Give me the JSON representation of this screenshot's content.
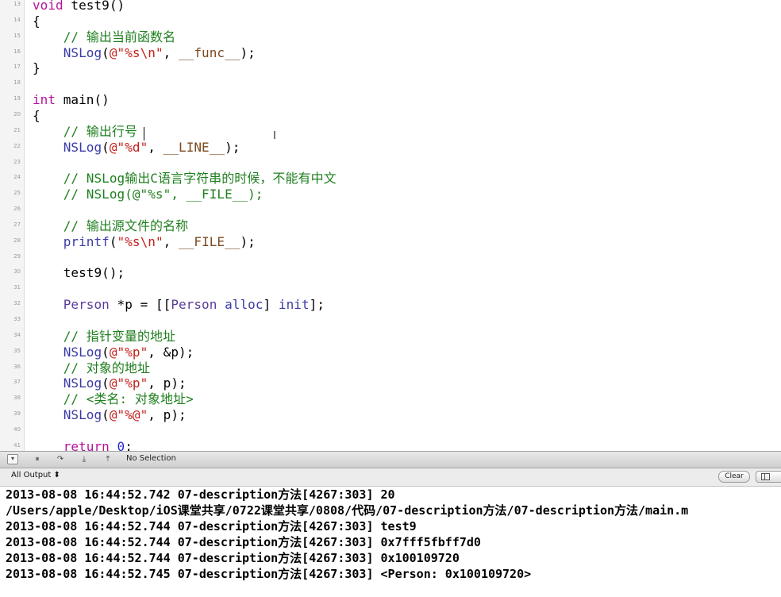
{
  "editor": {
    "lines": [
      {
        "n": "13",
        "code": [
          {
            "t": "void",
            "c": "kw"
          },
          {
            "t": " test9()"
          }
        ]
      },
      {
        "n": "14",
        "code": [
          {
            "t": "{"
          }
        ]
      },
      {
        "n": "15",
        "code": [
          {
            "t": "    // 输出当前函数名",
            "c": "cm"
          }
        ]
      },
      {
        "n": "16",
        "code": [
          {
            "t": "    "
          },
          {
            "t": "NSLog",
            "c": "fn"
          },
          {
            "t": "("
          },
          {
            "t": "@\"%s\\n\"",
            "c": "str"
          },
          {
            "t": ", "
          },
          {
            "t": "__func__",
            "c": "mac"
          },
          {
            "t": ");"
          }
        ]
      },
      {
        "n": "17",
        "code": [
          {
            "t": "}"
          }
        ]
      },
      {
        "n": "18",
        "code": []
      },
      {
        "n": "19",
        "code": [
          {
            "t": "int",
            "c": "kw"
          },
          {
            "t": " main()"
          }
        ]
      },
      {
        "n": "20",
        "code": [
          {
            "t": "{"
          }
        ]
      },
      {
        "n": "21",
        "code": [
          {
            "t": "    // 输出行号",
            "c": "cm"
          }
        ]
      },
      {
        "n": "22",
        "code": [
          {
            "t": "    "
          },
          {
            "t": "NSLog",
            "c": "fn"
          },
          {
            "t": "("
          },
          {
            "t": "@\"%d\"",
            "c": "str"
          },
          {
            "t": ", "
          },
          {
            "t": "__LINE__",
            "c": "mac"
          },
          {
            "t": ");"
          }
        ]
      },
      {
        "n": "23",
        "code": []
      },
      {
        "n": "24",
        "code": [
          {
            "t": "    // NSLog输出C语言字符串的时候，不能有中文",
            "c": "cm"
          }
        ]
      },
      {
        "n": "25",
        "code": [
          {
            "t": "    // NSLog(@\"%s\", __FILE__);",
            "c": "cm"
          }
        ]
      },
      {
        "n": "26",
        "code": []
      },
      {
        "n": "27",
        "code": [
          {
            "t": "    // 输出源文件的名称",
            "c": "cm"
          }
        ]
      },
      {
        "n": "28",
        "code": [
          {
            "t": "    "
          },
          {
            "t": "printf",
            "c": "fn"
          },
          {
            "t": "("
          },
          {
            "t": "\"%s\\n\"",
            "c": "str"
          },
          {
            "t": ", "
          },
          {
            "t": "__FILE__",
            "c": "mac"
          },
          {
            "t": ");"
          }
        ]
      },
      {
        "n": "29",
        "code": []
      },
      {
        "n": "30",
        "code": [
          {
            "t": "    test9();"
          }
        ]
      },
      {
        "n": "31",
        "code": []
      },
      {
        "n": "32",
        "code": [
          {
            "t": "    "
          },
          {
            "t": "Person",
            "c": "cls"
          },
          {
            "t": " *p = [["
          },
          {
            "t": "Person",
            "c": "cls"
          },
          {
            "t": " "
          },
          {
            "t": "alloc",
            "c": "fn"
          },
          {
            "t": "] "
          },
          {
            "t": "init",
            "c": "fn"
          },
          {
            "t": "];"
          }
        ]
      },
      {
        "n": "33",
        "code": []
      },
      {
        "n": "34",
        "code": [
          {
            "t": "    // 指针变量的地址",
            "c": "cm"
          }
        ]
      },
      {
        "n": "35",
        "code": [
          {
            "t": "    "
          },
          {
            "t": "NSLog",
            "c": "fn"
          },
          {
            "t": "("
          },
          {
            "t": "@\"%p\"",
            "c": "str"
          },
          {
            "t": ", &p);"
          }
        ]
      },
      {
        "n": "36",
        "code": [
          {
            "t": "    // 对象的地址",
            "c": "cm"
          }
        ]
      },
      {
        "n": "37",
        "code": [
          {
            "t": "    "
          },
          {
            "t": "NSLog",
            "c": "fn"
          },
          {
            "t": "("
          },
          {
            "t": "@\"%p\"",
            "c": "str"
          },
          {
            "t": ", p);"
          }
        ]
      },
      {
        "n": "38",
        "code": [
          {
            "t": "    // <类名: 对象地址>",
            "c": "cm"
          }
        ]
      },
      {
        "n": "39",
        "code": [
          {
            "t": "    "
          },
          {
            "t": "NSLog",
            "c": "fn"
          },
          {
            "t": "("
          },
          {
            "t": "@\"%@\"",
            "c": "str"
          },
          {
            "t": ", p);"
          }
        ]
      },
      {
        "n": "40",
        "code": []
      },
      {
        "n": "41",
        "code": [
          {
            "t": "    "
          },
          {
            "t": "return",
            "c": "kw"
          },
          {
            "t": " "
          },
          {
            "t": "0",
            "c": "num"
          },
          {
            "t": ";"
          }
        ]
      }
    ]
  },
  "debug_bar": {
    "hide_icon": "hide-debug-area-icon",
    "buttons": [
      {
        "name": "pause-icon",
        "glyph": "⏸"
      },
      {
        "name": "step-over-icon",
        "glyph": "↷"
      },
      {
        "name": "step-into-icon",
        "glyph": "⤓"
      },
      {
        "name": "step-out-icon",
        "glyph": "⤒"
      }
    ],
    "selection_label": "No Selection"
  },
  "output_header": {
    "filter_label": "All Output ⬍",
    "clear_label": "Clear"
  },
  "console": {
    "lines": [
      "2013-08-08 16:44:52.742 07-description方法[4267:303] 20",
      "/Users/apple/Desktop/iOS课堂共享/0722课堂共享/0808/代码/07-description方法/07-description方法/main.m",
      "2013-08-08 16:44:52.744 07-description方法[4267:303] test9",
      "2013-08-08 16:44:52.744 07-description方法[4267:303] 0x7fff5fbff7d0",
      "2013-08-08 16:44:52.744 07-description方法[4267:303] 0x100109720",
      "2013-08-08 16:44:52.745 07-description方法[4267:303] <Person: 0x100109720>"
    ]
  }
}
